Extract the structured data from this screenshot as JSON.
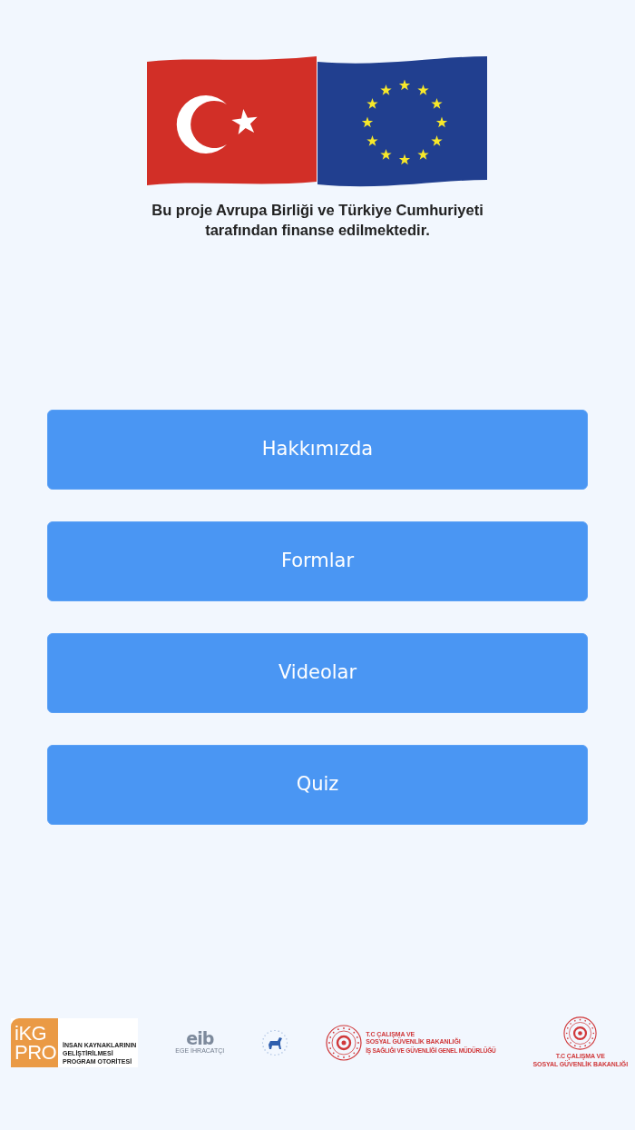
{
  "header": {
    "caption": "Bu proje Avrupa Birliği ve Türkiye Cumhuriyeti\ntarafından finanse edilmektedir."
  },
  "menu_buttons": [
    {
      "label": "Hakkımızda"
    },
    {
      "label": "Formlar"
    },
    {
      "label": "Videolar"
    },
    {
      "label": "Quiz"
    }
  ],
  "footer_logos": [
    {
      "kind": "tile_with_text",
      "mark": "iKG\nPRO",
      "name": "İNSAN KAYNAKLARININ\nGELİŞTİRİLMESİ\nPROGRAM OTORİTESİ"
    },
    {
      "kind": "wordmark",
      "mark": "eib",
      "name": "EGE İHRACATÇI"
    },
    {
      "kind": "emblem"
    },
    {
      "kind": "seal_beside",
      "name": "T.C ÇALIŞMA VE\nSOSYAL GÜVENLİK BAKANLIĞI",
      "subline": "İŞ SAĞLIĞI VE GÜVENLİĞİ GENEL MÜDÜRLÜĞÜ"
    },
    {
      "kind": "seal_above",
      "name": "T.C ÇALIŞMA VE\nSOSYAL GÜVENLİK BAKANLIĞI"
    }
  ]
}
